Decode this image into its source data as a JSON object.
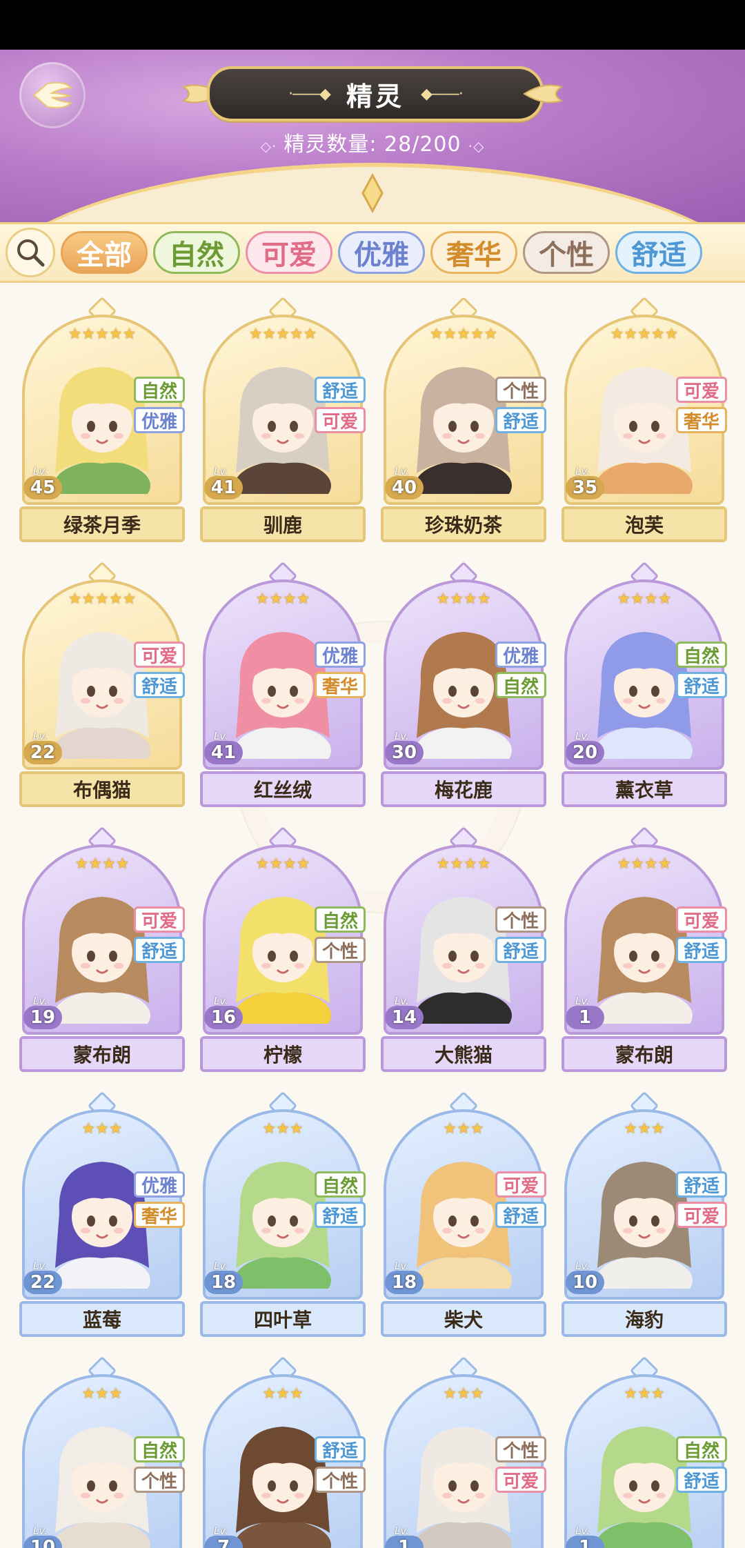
{
  "header": {
    "title": "精灵",
    "count_label": "精灵数量: 28/200",
    "title_deco_left": "·——◆",
    "title_deco_right": "◆——·"
  },
  "filters": [
    {
      "label": "全部",
      "active": true,
      "color": "#e8a556",
      "bg": "#f6c17a",
      "text": "#ffffff"
    },
    {
      "label": "自然",
      "color": "#8fba59",
      "bg": "#eef7dc",
      "text": "#6c9b36"
    },
    {
      "label": "可爱",
      "color": "#ee8ea4",
      "bg": "#fde8ed",
      "text": "#e06c88"
    },
    {
      "label": "优雅",
      "color": "#8ea2e3",
      "bg": "#eaeefc",
      "text": "#6c82cf"
    },
    {
      "label": "奢华",
      "color": "#e9b35e",
      "bg": "#fdf0d9",
      "text": "#d38c2c"
    },
    {
      "label": "个性",
      "color": "#b09685",
      "bg": "#f3ebe4",
      "text": "#8d6f5c"
    },
    {
      "label": "舒适",
      "color": "#6fb1e5",
      "bg": "#e3f2fc",
      "text": "#4c97d4"
    }
  ],
  "tag_styles": {
    "自然": {
      "border": "#8fba59",
      "text": "#6c9b36"
    },
    "可爱": {
      "border": "#ee8ea4",
      "text": "#e06c88"
    },
    "优雅": {
      "border": "#8ea2e3",
      "text": "#6c82cf"
    },
    "奢华": {
      "border": "#e9b35e",
      "text": "#d38c2c"
    },
    "个性": {
      "border": "#b09685",
      "text": "#8d6f5c"
    },
    "舒适": {
      "border": "#6fb1e5",
      "text": "#4c97d4"
    }
  },
  "rarity_styles": {
    "gold": {
      "frame": "#e5c578",
      "bg1": "#fff6d8",
      "bg2": "#f6dc9a",
      "plate": "#f6e3a8",
      "lv": "#d6a94f"
    },
    "purple": {
      "frame": "#b999d9",
      "bg1": "#ede3fa",
      "bg2": "#c9b1ec",
      "plate": "#e6d6f7",
      "lv": "#9877c9"
    },
    "blue": {
      "frame": "#9bb9e6",
      "bg1": "#e4efff",
      "bg2": "#b8cff2",
      "plate": "#d9e8fb",
      "lv": "#6f95d4"
    }
  },
  "spirits": [
    {
      "name": "绿茶月季",
      "level": "45",
      "stars": 5,
      "rarity": "gold",
      "tags": [
        "自然",
        "优雅"
      ],
      "hair": "#f3dd7a",
      "outfit": "#7fb25d"
    },
    {
      "name": "驯鹿",
      "level": "41",
      "stars": 5,
      "rarity": "gold",
      "tags": [
        "舒适",
        "可爱"
      ],
      "hair": "#d8cfc4",
      "outfit": "#5b4538"
    },
    {
      "name": "珍珠奶茶",
      "level": "40",
      "stars": 5,
      "rarity": "gold",
      "tags": [
        "个性",
        "舒适"
      ],
      "hair": "#c9b3a0",
      "outfit": "#3a2f2d"
    },
    {
      "name": "泡芙",
      "level": "35",
      "stars": 5,
      "rarity": "gold",
      "tags": [
        "可爱",
        "奢华"
      ],
      "hair": "#f3ebe1",
      "outfit": "#e9a96a"
    },
    {
      "name": "布偶猫",
      "level": "22",
      "stars": 5,
      "rarity": "gold",
      "tags": [
        "可爱",
        "舒适"
      ],
      "hair": "#efe9e4",
      "outfit": "#e2d6cf"
    },
    {
      "name": "红丝绒",
      "level": "41",
      "stars": 4,
      "rarity": "purple",
      "tags": [
        "优雅",
        "奢华"
      ],
      "hair": "#f08fa3",
      "outfit": "#f2f2f2"
    },
    {
      "name": "梅花鹿",
      "level": "30",
      "stars": 4,
      "rarity": "purple",
      "tags": [
        "优雅",
        "自然"
      ],
      "hair": "#b07a4e",
      "outfit": "#f2f2f2"
    },
    {
      "name": "薰衣草",
      "level": "20",
      "stars": 4,
      "rarity": "purple",
      "tags": [
        "自然",
        "舒适"
      ],
      "hair": "#8f9ae8",
      "outfit": "#dfe6fb"
    },
    {
      "name": "蒙布朗",
      "level": "19",
      "stars": 4,
      "rarity": "purple",
      "tags": [
        "可爱",
        "舒适"
      ],
      "hair": "#b88a5f",
      "outfit": "#f3efe8"
    },
    {
      "name": "柠檬",
      "level": "16",
      "stars": 4,
      "rarity": "purple",
      "tags": [
        "自然",
        "个性"
      ],
      "hair": "#f2e06b",
      "outfit": "#f4d03a"
    },
    {
      "name": "大熊猫",
      "level": "14",
      "stars": 4,
      "rarity": "purple",
      "tags": [
        "个性",
        "舒适"
      ],
      "hair": "#e4e4e4",
      "outfit": "#2d2d2d"
    },
    {
      "name": "蒙布朗",
      "level": "1",
      "stars": 4,
      "rarity": "purple",
      "tags": [
        "可爱",
        "舒适"
      ],
      "hair": "#b88a5f",
      "outfit": "#f3efe8"
    },
    {
      "name": "蓝莓",
      "level": "22",
      "stars": 3,
      "rarity": "blue",
      "tags": [
        "优雅",
        "奢华"
      ],
      "hair": "#5d4fb5",
      "outfit": "#f2f2f7"
    },
    {
      "name": "四叶草",
      "level": "18",
      "stars": 3,
      "rarity": "blue",
      "tags": [
        "自然",
        "舒适"
      ],
      "hair": "#b5d98a",
      "outfit": "#7ebf6a"
    },
    {
      "name": "柴犬",
      "level": "18",
      "stars": 3,
      "rarity": "blue",
      "tags": [
        "可爱",
        "舒适"
      ],
      "hair": "#f0c27a",
      "outfit": "#f5dca8"
    },
    {
      "name": "海豹",
      "level": "10",
      "stars": 3,
      "rarity": "blue",
      "tags": [
        "舒适",
        "可爱"
      ],
      "hair": "#9c8a77",
      "outfit": "#f1efeb"
    },
    {
      "name": "",
      "level": "10",
      "stars": 3,
      "rarity": "blue",
      "tags": [
        "自然",
        "个性"
      ],
      "hair": "#f1ece6",
      "outfit": "#e7dcd2"
    },
    {
      "name": "",
      "level": "7",
      "stars": 3,
      "rarity": "blue",
      "tags": [
        "舒适",
        "个性"
      ],
      "hair": "#6e4a33",
      "outfit": "#7a563c"
    },
    {
      "name": "",
      "level": "1",
      "stars": 3,
      "rarity": "blue",
      "tags": [
        "个性",
        "可爱"
      ],
      "hair": "#efe9e4",
      "outfit": "#d2c9c2"
    },
    {
      "name": "",
      "level": "1",
      "stars": 3,
      "rarity": "blue",
      "tags": [
        "自然",
        "舒适"
      ],
      "hair": "#b5d98a",
      "outfit": "#7ebf6a"
    }
  ]
}
